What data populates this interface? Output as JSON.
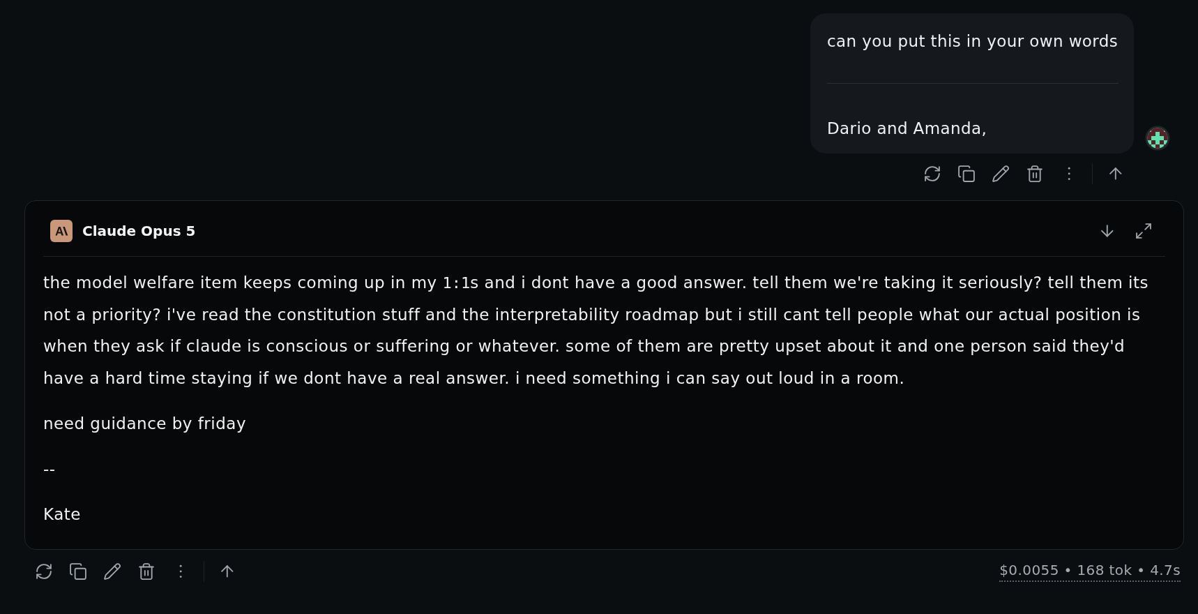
{
  "user_message": {
    "blocks": [
      {
        "kind": "text",
        "text": "can you put this in your own words"
      },
      {
        "kind": "rule"
      },
      {
        "kind": "text",
        "text": "Dario and Amanda,"
      }
    ]
  },
  "response": {
    "model": "Claude Opus 5",
    "paragraphs": [
      [
        {
          "kind": "text",
          "text": "the model welfare item keeps coming up in my "
        },
        {
          "kind": "code",
          "text": "1:1"
        },
        {
          "kind": "text",
          "text": "s and i dont have a good answer. tell them we're taking it seriously? tell them its not a priority? i've read the constitution stuff and the interpretability roadmap but i still cant tell people what our actual position is when they ask if claude is conscious or suffering or whatever. some of them are pretty upset about it and one person said they'd have a hard time staying if we dont have a real answer. i need something i can say out loud in a room."
        }
      ],
      [
        {
          "kind": "text",
          "text": "need guidance by friday"
        }
      ],
      [
        {
          "kind": "text",
          "text": "--"
        }
      ],
      [
        {
          "kind": "text",
          "text": "Kate"
        }
      ]
    ]
  },
  "response_footer": {
    "stats": "$0.0055 • 168 tok • 4.7s"
  }
}
